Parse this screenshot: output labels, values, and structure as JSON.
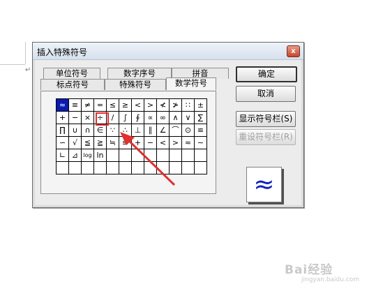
{
  "dialog": {
    "title": "插入特殊符号",
    "close_glyph": "x"
  },
  "tabs": {
    "row_back": [
      "单位符号",
      "数字序号",
      "拼音"
    ],
    "row_front": [
      "标点符号",
      "特殊符号",
      "数学符号"
    ],
    "active": "数学符号"
  },
  "symbols": [
    [
      "≈",
      "≡",
      "≠",
      "=",
      "≤",
      "≥",
      "<",
      ">",
      "≮",
      "≯",
      "∷",
      "±"
    ],
    [
      "+",
      "−",
      "×",
      "÷",
      "/",
      "∫",
      "∮",
      "∝",
      "∞",
      "∧",
      "∨",
      "∑"
    ],
    [
      "∏",
      "∪",
      "∩",
      "∈",
      "∵",
      "∴",
      "⊥",
      "∥",
      "∠",
      "⌒",
      "⊙",
      "≌"
    ],
    [
      "∽",
      "√",
      "≦",
      "≧",
      "≒",
      "≡",
      "+",
      "−",
      "<",
      ">",
      "≈",
      "∼"
    ],
    [
      "∟",
      "⊿",
      "log",
      "ln",
      "",
      "",
      "",
      "",
      "",
      "",
      "",
      ""
    ],
    [
      "",
      "",
      "",
      "",
      "",
      "",
      "",
      "",
      "",
      "",
      "",
      ""
    ]
  ],
  "selected_symbol": "≈",
  "highlighted_symbol": "÷",
  "buttons": {
    "ok": "确定",
    "cancel": "取消",
    "show_bar": "显示符号栏(S)",
    "reset_bar": "重设符号栏(R)"
  },
  "preview_symbol": "≈",
  "colors": {
    "selection": "#0a1ab0",
    "preview_symbol": "#1020c0",
    "highlight": "#e03030"
  },
  "watermark": {
    "brand": "Bai经验",
    "url": "jingyan.baidu.com"
  },
  "paragraph_mark": "↵"
}
